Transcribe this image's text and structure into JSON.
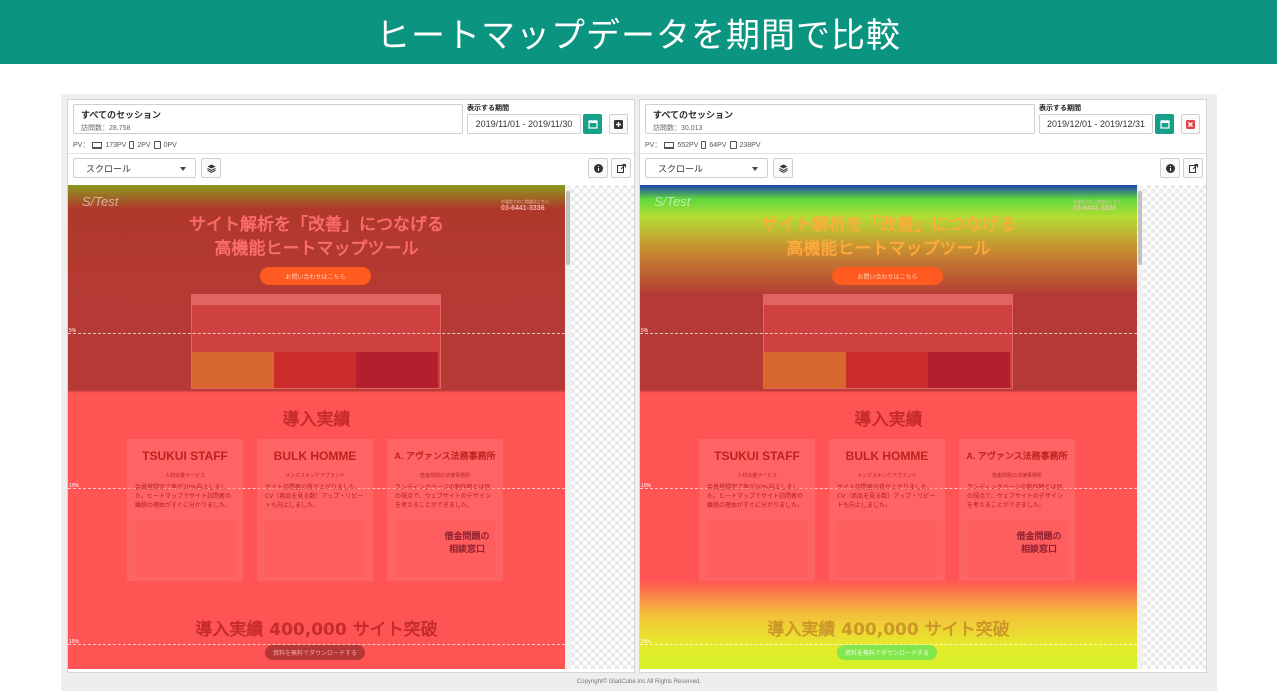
{
  "banner": {
    "title": "ヒートマップデータを期間で比較"
  },
  "copyright": "Copyright© GladCube.Inc All Rights Reserved.",
  "panels": [
    {
      "session_title": "すべてのセッション",
      "visits": "訪問数：28,758",
      "period_label": "表示する期間",
      "period": "2019/11/01 - 2019/11/30",
      "pv_prefix": "PV：",
      "pv_pc": "173PV",
      "pv_sp": "2PV",
      "pv_tab": "0PV",
      "mode": "スクロール",
      "action_icon": "plus-square-icon"
    },
    {
      "session_title": "すべてのセッション",
      "visits": "訪問数：30,013",
      "period_label": "表示する期間",
      "period": "2019/12/01 - 2019/12/31",
      "pv_prefix": "PV：",
      "pv_pc": "552PV",
      "pv_sp": "64PV",
      "pv_tab": "238PV",
      "mode": "スクロール",
      "action_icon": "close-square-icon"
    }
  ],
  "site": {
    "logo": "S/Test",
    "phone_small": "お電話でのご相談はこちら",
    "phone": "03-6441-3336",
    "hero_line1": "サイト解析を「改善」につなげる",
    "hero_line2": "高機能ヒートマップツール",
    "cta": "お問い合わせはこちら",
    "section_title": "導入実績",
    "bottom_title": "導入実績 400,000 サイト突破",
    "download": "資料を無料でダウンロードする",
    "cards": [
      {
        "logo": "TSUKUI STAFF",
        "sub": "人材派遣サービス",
        "text": "会員登録完了率が20%向上しました。ヒートマップでサイト訪問者の離脱の理由がすぐに分かりました。"
      },
      {
        "logo": "BULK HOMME",
        "sub": "メンズスキンケアブランド",
        "text": "サイト訪問者の質が上がりました。CV（商品を見る数）アップ・リピートも向上しました。"
      },
      {
        "logo": "A. アヴァンス法務事務所",
        "sub": "借金問題の法律事務所",
        "text": "ランディングページの制作時とは別の視点で、ウェブサイトのデザインを考えることができました。"
      }
    ],
    "card_badge": "借金問題の相談窓口"
  },
  "scroll_markers": [
    "5%",
    "10%",
    "15%"
  ],
  "colors": {
    "banner": "#0b9480",
    "accent": "#14a089",
    "danger": "#e04848"
  }
}
